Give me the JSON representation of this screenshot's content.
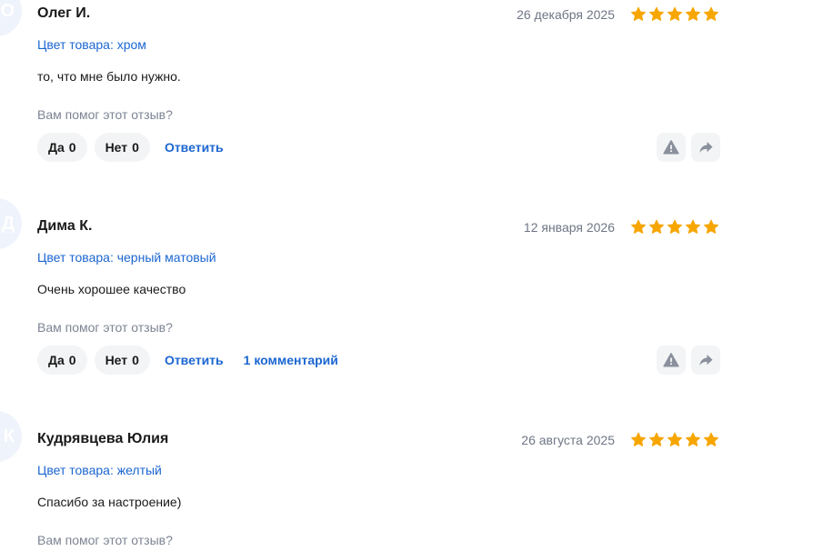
{
  "colors": {
    "star": "#f7a600",
    "link": "#1b66d1",
    "muted": "#7d8493",
    "pill_bg": "#f3f4f6",
    "avatar_bg": "#eef3fc"
  },
  "reviews": [
    {
      "avatar_letter": "О",
      "author": "Олег И.",
      "date": "26 декабря 2025",
      "rating": 5,
      "variant": "Цвет товара: хром",
      "text": "то, что мне было нужно.",
      "helpful_question": "Вам помог этот отзыв?",
      "yes_label": "Да",
      "yes_count": "0",
      "no_label": "Нет",
      "no_count": "0",
      "reply_label": "Ответить",
      "comments_label": "",
      "report_icon": "warning-icon",
      "share_icon": "share-arrow-icon"
    },
    {
      "avatar_letter": "Д",
      "author": "Дима К.",
      "date": "12 января 2026",
      "rating": 5,
      "variant": "Цвет товара: черный матовый",
      "text": "Очень хорошее качество",
      "helpful_question": "Вам помог этот отзыв?",
      "yes_label": "Да",
      "yes_count": "0",
      "no_label": "Нет",
      "no_count": "0",
      "reply_label": "Ответить",
      "comments_label": "1 комментарий",
      "report_icon": "warning-icon",
      "share_icon": "share-arrow-icon"
    },
    {
      "avatar_letter": "К",
      "author": "Кудрявцева Юлия",
      "date": "26 августа 2025",
      "rating": 5,
      "variant": "Цвет товара: желтый",
      "text": "Спасибо за настроение)",
      "helpful_question": "Вам помог этот отзыв?"
    }
  ]
}
